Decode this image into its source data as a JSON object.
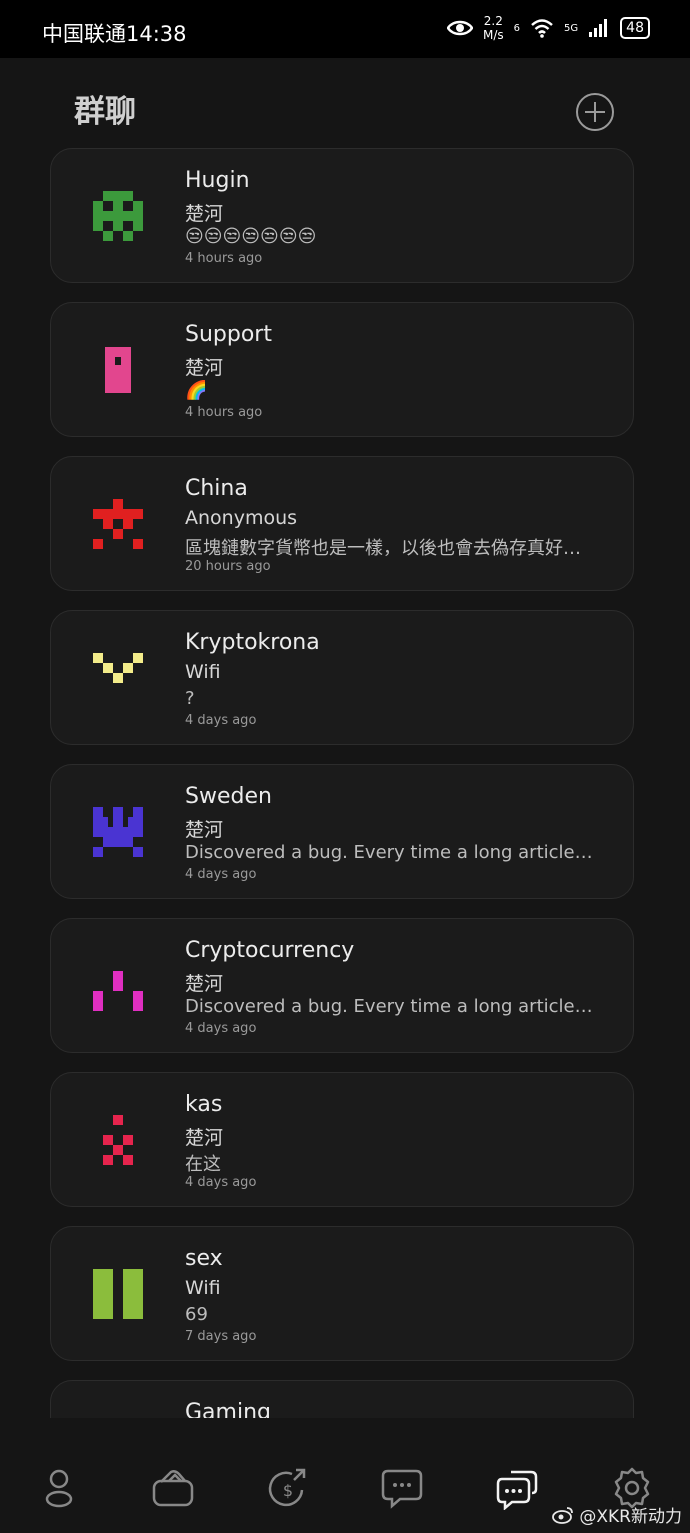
{
  "status_bar": {
    "carrier_time": "中国联通14:38",
    "speed_value": "2.2",
    "speed_unit": "M/s",
    "net_a": "6",
    "net_b": "5G",
    "battery": "48"
  },
  "header": {
    "title": "群聊",
    "add_icon": "plus-circle-icon"
  },
  "groups": [
    {
      "name": "Hugin",
      "user": "楚河",
      "message": "😒😒😒😒😒😒😒",
      "time": "4 hours ago",
      "avatar_color": "#3c9a3c"
    },
    {
      "name": "Support",
      "user": "楚河",
      "message": "🌈",
      "time": "4 hours ago",
      "avatar_color": "#e2468e"
    },
    {
      "name": "China",
      "user": "Anonymous",
      "message": "區塊鏈數字貨幣也是一樣，以後也會去偽存真好…",
      "time": "20 hours ago",
      "avatar_color": "#e02020"
    },
    {
      "name": "Kryptokrona",
      "user": "Wifi",
      "message": "?",
      "time": "4 days ago",
      "avatar_color": "#f3ec8a"
    },
    {
      "name": "Sweden",
      "user": "楚河",
      "message": "Discovered a bug. Every time a long article…",
      "time": "4 days ago",
      "avatar_color": "#4a34d2"
    },
    {
      "name": "Cryptocurrency",
      "user": "楚河",
      "message": "Discovered a bug. Every time a long article…",
      "time": "4 days ago",
      "avatar_color": "#e02fc1"
    },
    {
      "name": "kas",
      "user": "楚河",
      "message": "在这",
      "time": "4 days ago",
      "avatar_color": "#e6244d"
    },
    {
      "name": "sex",
      "user": "Wifi",
      "message": "69",
      "time": "7 days ago",
      "avatar_color": "#8bbd3c"
    },
    {
      "name": "Gaming",
      "user": "",
      "message": "",
      "time": "",
      "avatar_color": "#888888"
    }
  ],
  "nav": [
    {
      "icon": "user-icon"
    },
    {
      "icon": "wallet-icon"
    },
    {
      "icon": "dollar-transfer-icon"
    },
    {
      "icon": "chat-bubble-icon"
    },
    {
      "icon": "group-chat-icon",
      "active": true
    },
    {
      "icon": "gear-icon"
    }
  ],
  "watermark": "@XKR新动力"
}
